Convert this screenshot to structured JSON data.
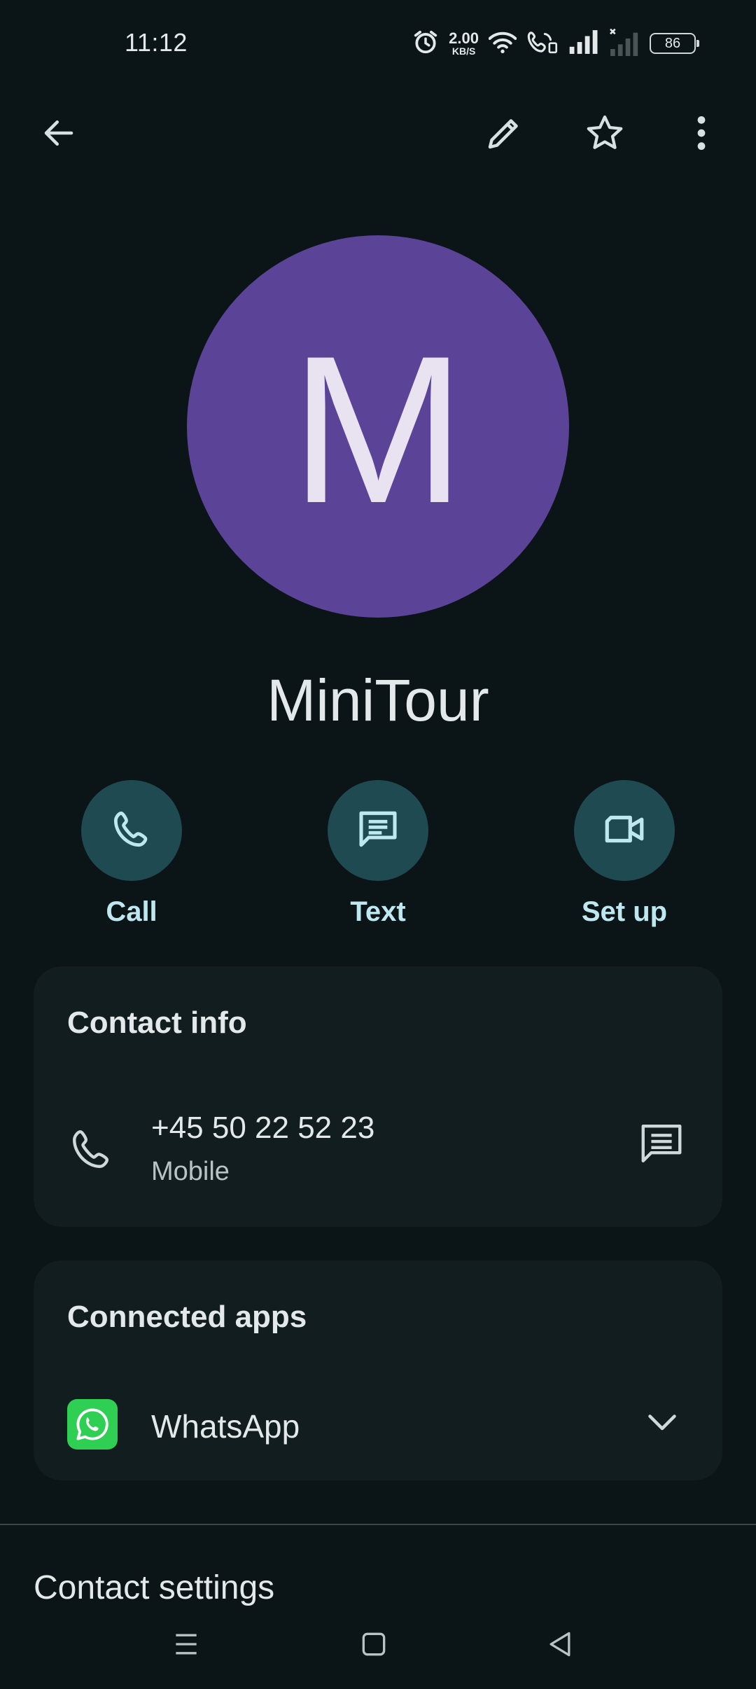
{
  "status_bar": {
    "time": "11:12",
    "net_speed_value": "2.00",
    "net_speed_unit": "KB/S",
    "battery": "86",
    "icons": [
      "alarm-icon",
      "wifi-icon",
      "wifi-calling-icon",
      "signal-icon",
      "no-signal-icon",
      "battery-icon"
    ]
  },
  "top_bar": {
    "icons": [
      "back-arrow-icon",
      "edit-pencil-icon",
      "star-outline-icon",
      "more-vert-icon"
    ]
  },
  "contact": {
    "initial": "M",
    "name": "MiniTour",
    "avatar_color": "#5b4397"
  },
  "actions": [
    {
      "label": "Call",
      "icon": "phone-icon"
    },
    {
      "label": "Text",
      "icon": "message-icon"
    },
    {
      "label": "Set up",
      "icon": "video-call-icon"
    }
  ],
  "contact_info": {
    "title": "Contact info",
    "phone_number": "+45 50 22 52 23",
    "phone_type": "Mobile"
  },
  "connected_apps": {
    "title": "Connected apps",
    "app_name": "WhatsApp"
  },
  "contact_settings": {
    "title": "Contact settings"
  },
  "nav_bar": {
    "icons": [
      "menu-icon",
      "home-square-icon",
      "back-triangle-icon"
    ]
  },
  "colors": {
    "background": "#0b1416",
    "card": "#121d20",
    "action_circle": "#1f4a52",
    "action_label": "#bfe7f0",
    "whatsapp_green": "#2fcf54"
  }
}
